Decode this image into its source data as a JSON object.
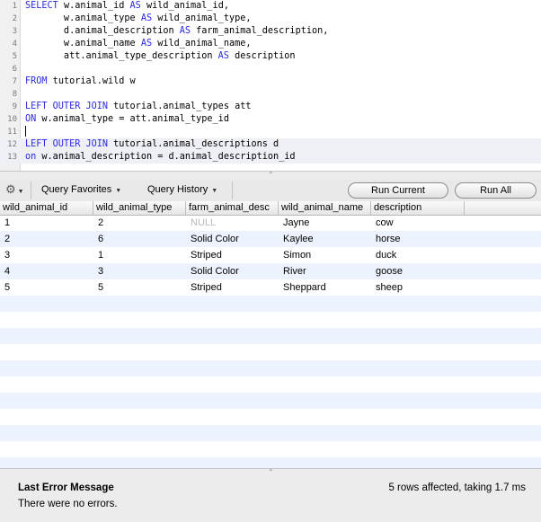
{
  "editor": {
    "lines": [
      {
        "n": "1",
        "tokens": [
          {
            "t": "SELECT",
            "k": true
          },
          {
            "t": " w.animal_id "
          },
          {
            "t": "AS",
            "k": true
          },
          {
            "t": " wild_animal_id,"
          }
        ]
      },
      {
        "n": "2",
        "tokens": [
          {
            "t": "       w.animal_type "
          },
          {
            "t": "AS",
            "k": true
          },
          {
            "t": " wild_animal_type,"
          }
        ]
      },
      {
        "n": "3",
        "tokens": [
          {
            "t": "       d.animal_description "
          },
          {
            "t": "AS",
            "k": true
          },
          {
            "t": " farm_animal_description,"
          }
        ]
      },
      {
        "n": "4",
        "tokens": [
          {
            "t": "       w.animal_name "
          },
          {
            "t": "AS",
            "k": true
          },
          {
            "t": " wild_animal_name,"
          }
        ]
      },
      {
        "n": "5",
        "tokens": [
          {
            "t": "       att.animal_type_description "
          },
          {
            "t": "AS",
            "k": true
          },
          {
            "t": " description"
          }
        ]
      },
      {
        "n": "6",
        "tokens": []
      },
      {
        "n": "7",
        "tokens": [
          {
            "t": "FROM",
            "k": true
          },
          {
            "t": " tutorial.wild w"
          }
        ]
      },
      {
        "n": "8",
        "tokens": []
      },
      {
        "n": "9",
        "tokens": [
          {
            "t": "LEFT OUTER JOIN",
            "k": true
          },
          {
            "t": " tutorial.animal_types att"
          }
        ]
      },
      {
        "n": "10",
        "tokens": [
          {
            "t": "ON",
            "k": true
          },
          {
            "t": " w.animal_type = att.animal_type_id"
          }
        ]
      },
      {
        "n": "11",
        "tokens": [],
        "caret": true
      },
      {
        "n": "12",
        "tokens": [
          {
            "t": "LEFT OUTER JOIN",
            "k": true
          },
          {
            "t": " tutorial.animal_descriptions d"
          }
        ]
      },
      {
        "n": "13",
        "tokens": [
          {
            "t": "on",
            "k": true
          },
          {
            "t": " w.animal_description = d.animal_description_id"
          }
        ]
      }
    ]
  },
  "toolbar": {
    "gear_icon": "gear-icon",
    "favorites_label": "Query Favorites",
    "history_label": "Query History",
    "run_current_label": "Run Current",
    "run_all_label": "Run All"
  },
  "results": {
    "columns": [
      "wild_animal_id",
      "wild_animal_type",
      "farm_animal_desc",
      "wild_animal_name",
      "description"
    ],
    "rows": [
      [
        "1",
        "2",
        "NULL",
        "Jayne",
        "cow"
      ],
      [
        "2",
        "6",
        "Solid Color",
        "Kaylee",
        "horse"
      ],
      [
        "3",
        "1",
        "Striped",
        "Simon",
        "duck"
      ],
      [
        "4",
        "3",
        "Solid Color",
        "River",
        "goose"
      ],
      [
        "5",
        "5",
        "Striped",
        "Sheppard",
        "sheep"
      ]
    ]
  },
  "status": {
    "error_title": "Last Error Message",
    "error_message": "There were no errors.",
    "rows_affected": "5 rows affected, taking 1.7 ms"
  },
  "colors": {
    "keyword": "#2a2ae0",
    "row_alt": "#edf3fe",
    "null_text": "#b8b8b8"
  }
}
